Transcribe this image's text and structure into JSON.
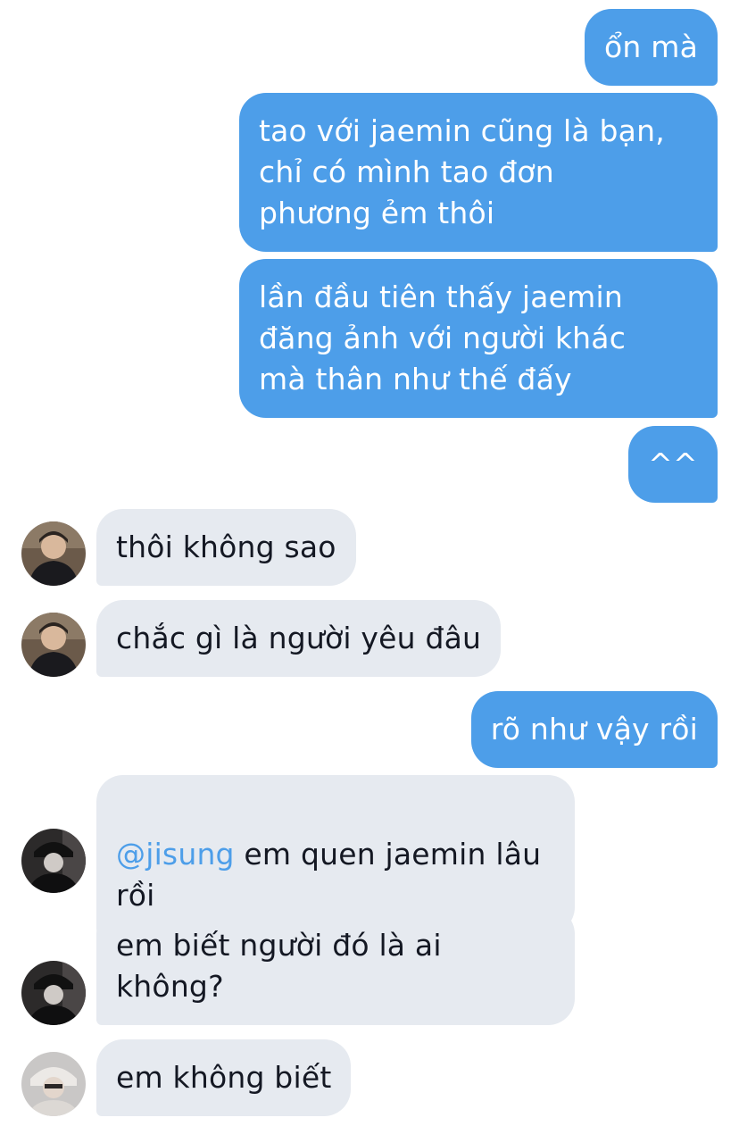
{
  "messages": [
    {
      "dir": "out",
      "text": "ổn mà"
    },
    {
      "dir": "out",
      "text": "tao với jaemin cũng là bạn,\nchỉ có mình tao đơn\nphương ẻm thôi"
    },
    {
      "dir": "out",
      "text": "lần đầu tiên thấy jaemin\nđăng ảnh với người khác\nmà thân như thế đấy"
    },
    {
      "dir": "out",
      "text": "^^"
    },
    {
      "dir": "in",
      "avatar": "avatar-user-a",
      "text": "thôi không sao"
    },
    {
      "dir": "in",
      "avatar": "avatar-user-a",
      "text": "chắc gì là người yêu đâu"
    },
    {
      "dir": "out",
      "text": "rõ như vậy rồi"
    },
    {
      "dir": "in",
      "avatar": "avatar-user-b",
      "mention": "@jisung",
      "text": " em quen jaemin lâu\nrồi"
    },
    {
      "dir": "in",
      "avatar": "avatar-user-b",
      "text": "em biết người đó là ai\nkhông?"
    },
    {
      "dir": "in",
      "avatar": "avatar-user-c",
      "text": "em không biết"
    }
  ],
  "colors": {
    "outgoing_bubble": "#4d9ee9",
    "incoming_bubble": "#e6eaf0",
    "incoming_text": "#141823",
    "mention": "#4d9ee9"
  }
}
